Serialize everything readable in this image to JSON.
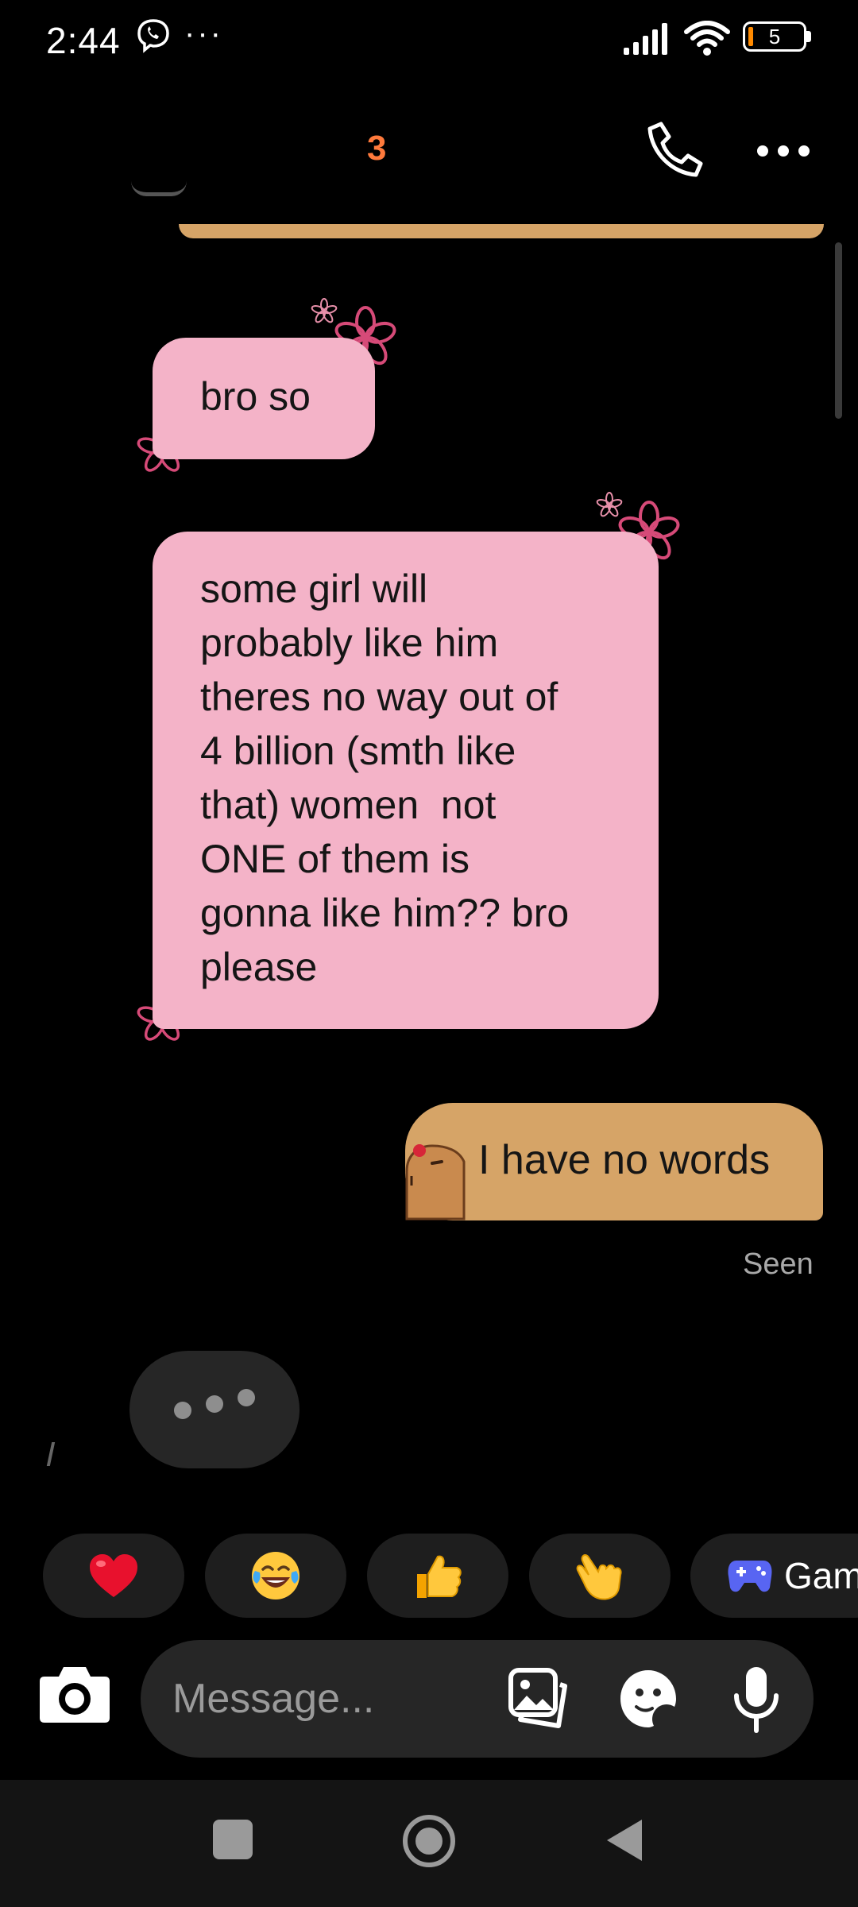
{
  "status_bar": {
    "time": "2:44",
    "more": "···",
    "battery": "5"
  },
  "header": {
    "contact_name_fragment": "3"
  },
  "messages": [
    {
      "from": "them",
      "lines": [
        "bro so"
      ]
    },
    {
      "from": "them",
      "lines": [
        "some girl will",
        "probably like him",
        "theres no way out of",
        "4 billion (smth like",
        "that) women  not",
        "ONE of them is",
        "gonna like him?? bro",
        "please"
      ]
    },
    {
      "from": "me",
      "lines": [
        "I have no words"
      ]
    }
  ],
  "seen_label": "Seen",
  "quick_reactions": [
    {
      "name": "red-heart",
      "glyph": "❤️"
    },
    {
      "name": "tears-of-joy",
      "glyph": "😂"
    },
    {
      "name": "thumbs-up",
      "glyph": "👍"
    },
    {
      "name": "pointing-hand",
      "glyph": "👆"
    }
  ],
  "games_label": "Gam",
  "composer": {
    "placeholder": "Message..."
  },
  "colors": {
    "their_bubble": "#f4b3c8",
    "my_bubble": "#d6a467",
    "flower": "#d64a78"
  },
  "icons": [
    "viber-icon",
    "signal-icon",
    "wifi-icon",
    "battery-icon",
    "phone-icon",
    "more-options-icon",
    "camera-icon",
    "gallery-icon",
    "sticker-icon",
    "microphone-icon",
    "gamepad-icon",
    "capybara-sticker",
    "flower-decoration",
    "recents-icon",
    "home-icon",
    "back-icon"
  ]
}
